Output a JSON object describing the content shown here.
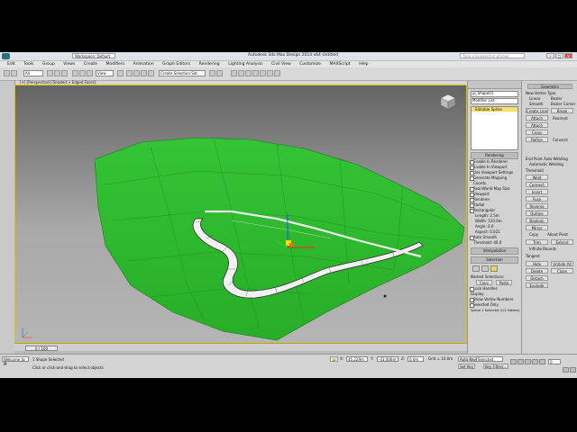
{
  "titlebar": {
    "app_title": "Autodesk 3ds Max Design 2014 x64    Untitled",
    "quick_access": "Workspace: Default",
    "search_placeholder": "Type a keyword or phrase"
  },
  "menu": [
    "Edit",
    "Tools",
    "Group",
    "Views",
    "Create",
    "Modifiers",
    "Animation",
    "Graph Editors",
    "Rendering",
    "Lighting Analysis",
    "Civil View",
    "Customize",
    "MAXScript",
    "Help"
  ],
  "toolbar": {
    "filter": "All",
    "coord": "View",
    "selection_set": "Create Selection Set"
  },
  "viewport": {
    "label": "[+] [Perspective] [Shaded + Edged Faces]"
  },
  "timebar": {
    "frame_slider": "0 / 100"
  },
  "status": {
    "maxscript": "Welcome to M",
    "selection": "1 Shape Selected",
    "prompt": "Click or click-and-drag to select objects",
    "x_label": "X:",
    "x_value": "45.229m",
    "y_label": "Y:",
    "y_value": "-43.406m",
    "z_label": "Z:",
    "z_value": "0.0m",
    "grid": "Grid = 10.0m",
    "auto_key": "Auto Key",
    "selected": "Selected",
    "set_key": "Set Key",
    "key_filters": "Key Filters...",
    "frame": "0"
  },
  "command_panel": {
    "object_name": "pl_Shape01",
    "modifier_list": "Modifier List",
    "stack_item": "Editable Spline",
    "rollouts": {
      "rendering": "Rendering",
      "interpolation": "Interpolation",
      "selection": "Selection"
    },
    "options": [
      "Enable In Renderer",
      "Enable In Viewport",
      "Use Viewport Settings",
      "Generate Mapping Coords.",
      "Real-World Map Size"
    ],
    "radio": [
      "Viewport",
      "Renderer",
      "Radial",
      "Rectangular"
    ],
    "fields": [
      {
        "label": "Length:",
        "value": "2.5m"
      },
      {
        "label": "Width:",
        "value": "120.0m"
      },
      {
        "label": "Angle:",
        "value": "0.0"
      },
      {
        "label": "Aspect:",
        "value": "0.021"
      }
    ],
    "auto_smooth": "Auto Smooth",
    "threshold_label": "Threshold:",
    "threshold_value": "40.0",
    "named_selections": "Named Selections:",
    "copy": "Copy",
    "paste": "Paste",
    "lock_handles": "Lock Handles",
    "display_label": "Display",
    "show_vertex_numbers": "Show Vertex Numbers",
    "selected_only": "Selected Only",
    "spline_selected": "Spline 1 Selected (1/1 hidden)"
  },
  "right_panel": {
    "geometry": "Geometry",
    "new_vertex_type": "New Vertex Type",
    "linear": "Linear",
    "bezier": "Bezier",
    "smooth": "Smooth",
    "bezier_corner": "Bezier Corner",
    "create_line": "Create Line",
    "break": "Break",
    "attach": "Attach",
    "reorient": "Reorient",
    "attach_mult": "Attach Mult.",
    "cross_section": "Cross Section",
    "refine": "Refine",
    "connect": "Connect",
    "end_point_auto_welding": "End Point Auto-Welding",
    "auto_welding": "Automatic Welding",
    "threshold_distance": "Threshold",
    "weld": "Weld",
    "fuse": "Fuse",
    "insert": "Insert",
    "reverse": "Reverse",
    "outline": "Outline",
    "boolean": "Boolean",
    "mirror": "Mirror",
    "copy": "Copy",
    "about_pivot": "About Pivot",
    "trim": "Trim",
    "extend": "Extend",
    "infinite_bounds": "Infinite Bounds",
    "tangent": "Tangent",
    "hide": "Hide",
    "unhide_all": "Unhide All",
    "delete": "Delete",
    "close": "Close",
    "detach": "Detach",
    "explode": "Explode"
  },
  "colors": {
    "terrain": "#2fc02f",
    "terrain_dark": "#1f8f1f",
    "viewport_border": "#e0c000",
    "stack_highlight": "#f7e06a"
  }
}
